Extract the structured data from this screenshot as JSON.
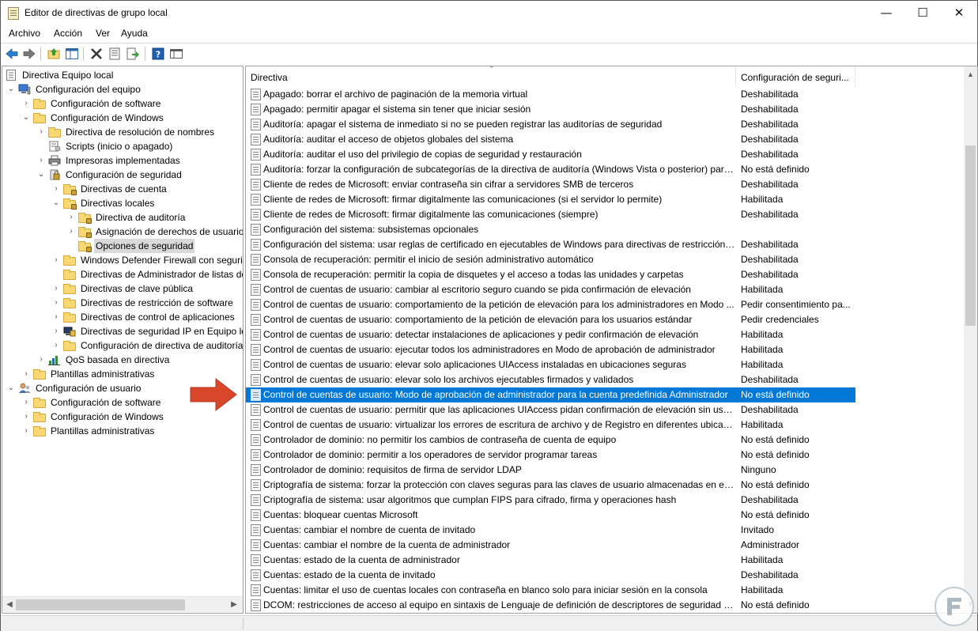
{
  "window": {
    "title": "Editor de directivas de grupo local",
    "controls": {
      "minimize": "—",
      "maximize": "☐",
      "close": "✕"
    }
  },
  "menubar": [
    "Archivo",
    "Acción",
    "Ver",
    "Ayuda"
  ],
  "toolbar": [
    "back-arrow-icon",
    "forward-arrow-icon",
    "up-folder-icon",
    "show-hide-tree-icon",
    "delete-icon",
    "properties-icon",
    "export-list-icon",
    "help-icon",
    "console-view-icon"
  ],
  "tree": {
    "root": "Directiva Equipo local",
    "items": [
      {
        "label": "Configuración del equipo",
        "expander": "⌄",
        "icon": "computer-icon"
      },
      {
        "label": "Configuración de software",
        "expander": "›",
        "icon": "folder-icon"
      },
      {
        "label": "Configuración de Windows",
        "expander": "⌄",
        "icon": "folder-icon"
      },
      {
        "label": "Directiva de resolución de nombres",
        "expander": "›",
        "icon": "folder-icon"
      },
      {
        "label": "Scripts (inicio o apagado)",
        "expander": "",
        "icon": "script-icon"
      },
      {
        "label": "Impresoras implementadas",
        "expander": "›",
        "icon": "printer-icon"
      },
      {
        "label": "Configuración de seguridad",
        "expander": "⌄",
        "icon": "security-icon"
      },
      {
        "label": "Directivas de cuenta",
        "expander": "›",
        "icon": "locked-folder-icon"
      },
      {
        "label": "Directivas locales",
        "expander": "⌄",
        "icon": "locked-folder-icon"
      },
      {
        "label": "Directiva de auditoría",
        "expander": "›",
        "icon": "locked-folder-icon"
      },
      {
        "label": "Asignación de derechos de usuario",
        "expander": "›",
        "icon": "locked-folder-icon"
      },
      {
        "label": "Opciones de seguridad",
        "expander": "",
        "icon": "locked-folder-icon"
      },
      {
        "label": "Windows Defender Firewall con seguridad avanzada",
        "expander": "›",
        "icon": "folder-icon"
      },
      {
        "label": "Directivas de Administrador de listas de redes",
        "expander": "",
        "icon": "folder-icon"
      },
      {
        "label": "Directivas de clave pública",
        "expander": "›",
        "icon": "folder-icon"
      },
      {
        "label": "Directivas de restricción de software",
        "expander": "›",
        "icon": "folder-icon"
      },
      {
        "label": "Directivas de control de aplicaciones",
        "expander": "›",
        "icon": "folder-icon"
      },
      {
        "label": "Directivas de seguridad IP en Equipo local",
        "expander": "›",
        "icon": "ip-security-icon"
      },
      {
        "label": "Configuración de directiva de auditoría avanzada",
        "expander": "›",
        "icon": "folder-icon"
      },
      {
        "label": "QoS basada en directiva",
        "expander": "›",
        "icon": "qos-chart-icon"
      },
      {
        "label": "Plantillas administrativas",
        "expander": "›",
        "icon": "folder-icon"
      },
      {
        "label": "Configuración de usuario",
        "expander": "⌄",
        "icon": "user-icon"
      },
      {
        "label": "Configuración de software",
        "expander": "›",
        "icon": "folder-icon"
      },
      {
        "label": "Configuración de Windows",
        "expander": "›",
        "icon": "folder-icon"
      },
      {
        "label": "Plantillas administrativas",
        "expander": "›",
        "icon": "folder-icon"
      }
    ],
    "selected": "Opciones de seguridad"
  },
  "list": {
    "columns": [
      "Directiva",
      "Configuración de seguri..."
    ],
    "rows": [
      {
        "name": "Apagado: borrar el archivo de paginación de la memoria virtual",
        "value": "Deshabilitada"
      },
      {
        "name": "Apagado: permitir apagar el sistema sin tener que iniciar sesión",
        "value": "Deshabilitada"
      },
      {
        "name": "Auditoría: apagar el sistema de inmediato si no se pueden registrar las auditorías de seguridad",
        "value": "Deshabilitada"
      },
      {
        "name": "Auditoría: auditar el acceso de objetos globales del sistema",
        "value": "Deshabilitada"
      },
      {
        "name": "Auditoría: auditar el uso del privilegio de copias de seguridad y restauración",
        "value": "Deshabilitada"
      },
      {
        "name": "Auditoría: forzar la configuración de subcategorías de la directiva de auditoría (Windows Vista o posterior) para ...",
        "value": "No está definido"
      },
      {
        "name": "Cliente de redes de Microsoft: enviar contraseña sin cifrar a servidores SMB de terceros",
        "value": "Deshabilitada"
      },
      {
        "name": "Cliente de redes de Microsoft: firmar digitalmente las comunicaciones (si el servidor lo permite)",
        "value": "Habilitada"
      },
      {
        "name": "Cliente de redes de Microsoft: firmar digitalmente las comunicaciones (siempre)",
        "value": "Deshabilitada"
      },
      {
        "name": "Configuración del sistema: subsistemas opcionales",
        "value": ""
      },
      {
        "name": "Configuración del sistema: usar reglas de certificado en ejecutables de Windows para directivas de restricción d...",
        "value": "Deshabilitada"
      },
      {
        "name": "Consola de recuperación: permitir el inicio de sesión administrativo automático",
        "value": "Deshabilitada"
      },
      {
        "name": "Consola de recuperación: permitir la copia de disquetes y el acceso a todas las unidades y carpetas",
        "value": "Deshabilitada"
      },
      {
        "name": "Control de cuentas de usuario: cambiar al escritorio seguro cuando se pida confirmación de elevación",
        "value": "Habilitada"
      },
      {
        "name": "Control de cuentas de usuario: comportamiento de la petición de elevación para los administradores en Modo ...",
        "value": "Pedir consentimiento pa..."
      },
      {
        "name": "Control de cuentas de usuario: comportamiento de la petición de elevación para los usuarios estándar",
        "value": "Pedir credenciales"
      },
      {
        "name": "Control de cuentas de usuario: detectar instalaciones de aplicaciones y pedir confirmación de elevación",
        "value": "Habilitada"
      },
      {
        "name": "Control de cuentas de usuario: ejecutar todos los administradores en Modo de aprobación de administrador",
        "value": "Habilitada"
      },
      {
        "name": "Control de cuentas de usuario: elevar solo aplicaciones UIAccess instaladas en ubicaciones seguras",
        "value": "Habilitada"
      },
      {
        "name": "Control de cuentas de usuario: elevar solo los archivos ejecutables firmados y validados",
        "value": "Deshabilitada"
      },
      {
        "name": "Control de cuentas de usuario: Modo de aprobación de administrador para la cuenta predefinida Administrador",
        "value": "No está definido"
      },
      {
        "name": "Control de cuentas de usuario: permitir que las aplicaciones UIAccess pidan confirmación de elevación sin usar ...",
        "value": "Deshabilitada"
      },
      {
        "name": "Control de cuentas de usuario: virtualizar los errores de escritura de archivo y de Registro en diferentes ubicacio...",
        "value": "Habilitada"
      },
      {
        "name": "Controlador de dominio: no permitir los cambios de contraseña de cuenta de equipo",
        "value": "No está definido"
      },
      {
        "name": "Controlador de dominio: permitir a los operadores de servidor programar tareas",
        "value": "No está definido"
      },
      {
        "name": "Controlador de dominio: requisitos de firma de servidor LDAP",
        "value": "Ninguno"
      },
      {
        "name": "Criptografía de sistema: forzar la protección con claves seguras para las claves de usuario almacenadas en el eq...",
        "value": "No está definido"
      },
      {
        "name": "Criptografía de sistema: usar algoritmos que cumplan FIPS para cifrado, firma y operaciones hash",
        "value": "Deshabilitada"
      },
      {
        "name": "Cuentas: bloquear cuentas Microsoft",
        "value": "No está definido"
      },
      {
        "name": "Cuentas: cambiar el nombre de cuenta de invitado",
        "value": "Invitado"
      },
      {
        "name": "Cuentas: cambiar el nombre de la cuenta de administrador",
        "value": "Administrador"
      },
      {
        "name": "Cuentas: estado de la cuenta de administrador",
        "value": "Habilitada"
      },
      {
        "name": "Cuentas: estado de la cuenta de invitado",
        "value": "Deshabilitada"
      },
      {
        "name": "Cuentas: limitar el uso de cuentas locales con contraseña en blanco solo para iniciar sesión en la consola",
        "value": "Habilitada"
      },
      {
        "name": "DCOM: restricciones de acceso al equipo en sintaxis de Lenguaje de definición de descriptores de seguridad (SD...",
        "value": "No está definido"
      }
    ],
    "selected_index": 20
  },
  "colors": {
    "selection_blue": "#0078d7",
    "annotation_arrow": "#d9472b",
    "tree_selection": "#d9d9d9"
  }
}
